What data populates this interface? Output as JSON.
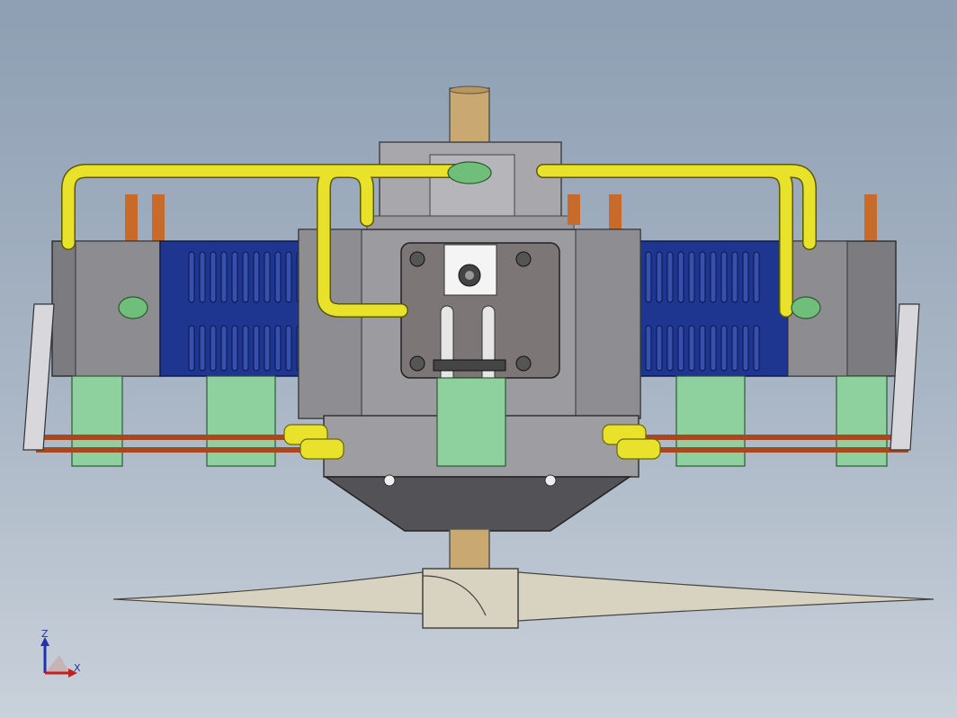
{
  "viewport": {
    "background_top": "#8e9fb3",
    "background_bottom": "#c9d1da"
  },
  "model": {
    "parts": [
      "crankcase",
      "output-shaft",
      "top-housing",
      "left-cylinder",
      "right-cylinder",
      "fuel-lines",
      "propeller",
      "linkage-rods",
      "mounting-brackets"
    ],
    "colors": {
      "cylinder_blue": "#1f3690",
      "fuel_line_yellow": "#e8e22a",
      "copper_tube": "#c86a2a",
      "shaft_tan": "#c9a871",
      "housing_gray": "#9b9ba0",
      "bracket_green": "#8fd19e",
      "propeller_beige": "#d8d2c0"
    }
  },
  "triad": {
    "z_label": "Z",
    "x_label": "X"
  }
}
